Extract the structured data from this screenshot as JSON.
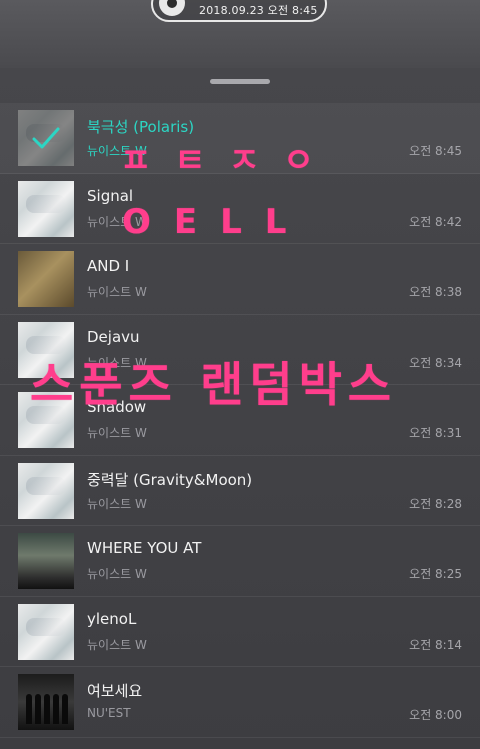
{
  "now_playing": {
    "timestamp": "2018.09.23 오전 8:45"
  },
  "tracks": [
    {
      "title": "북극성 (Polaris)",
      "artist": "뉴이스트 W",
      "time": "오전 8:45",
      "thumb": "kind-w",
      "active": true
    },
    {
      "title": "Signal",
      "artist": "뉴이스트 W",
      "time": "오전 8:42",
      "thumb": "kind-w",
      "active": false
    },
    {
      "title": "AND I",
      "artist": "뉴이스트 W",
      "time": "오전 8:38",
      "thumb": "kind-andi",
      "active": false
    },
    {
      "title": "Dejavu",
      "artist": "뉴이스트 W",
      "time": "오전 8:34",
      "thumb": "kind-w",
      "active": false
    },
    {
      "title": "Shadow",
      "artist": "뉴이스트 W",
      "time": "오전 8:31",
      "thumb": "kind-w",
      "active": false
    },
    {
      "title": "중력달 (Gravity&Moon)",
      "artist": "뉴이스트 W",
      "time": "오전 8:28",
      "thumb": "kind-w",
      "active": false
    },
    {
      "title": "WHERE YOU AT",
      "artist": "뉴이스트 W",
      "time": "오전 8:25",
      "thumb": "kind-where",
      "active": false
    },
    {
      "title": "ylenoL",
      "artist": "뉴이스트 W",
      "time": "오전 8:14",
      "thumb": "kind-w",
      "active": false
    },
    {
      "title": "여보세요",
      "artist": "NU'EST",
      "time": "오전 8:00",
      "thumb": "kind-hello",
      "active": false
    }
  ],
  "overlay": {
    "line1": "ㅍㅌㅈㅇ",
    "line2": "OELL",
    "line3": "스푼즈 랜덤박스"
  },
  "colors": {
    "accent": "#2cd6c4",
    "overlay_pink": "#ff3e8c"
  },
  "icons": {
    "disc": "vinyl-disc-icon",
    "check": "check-icon"
  }
}
